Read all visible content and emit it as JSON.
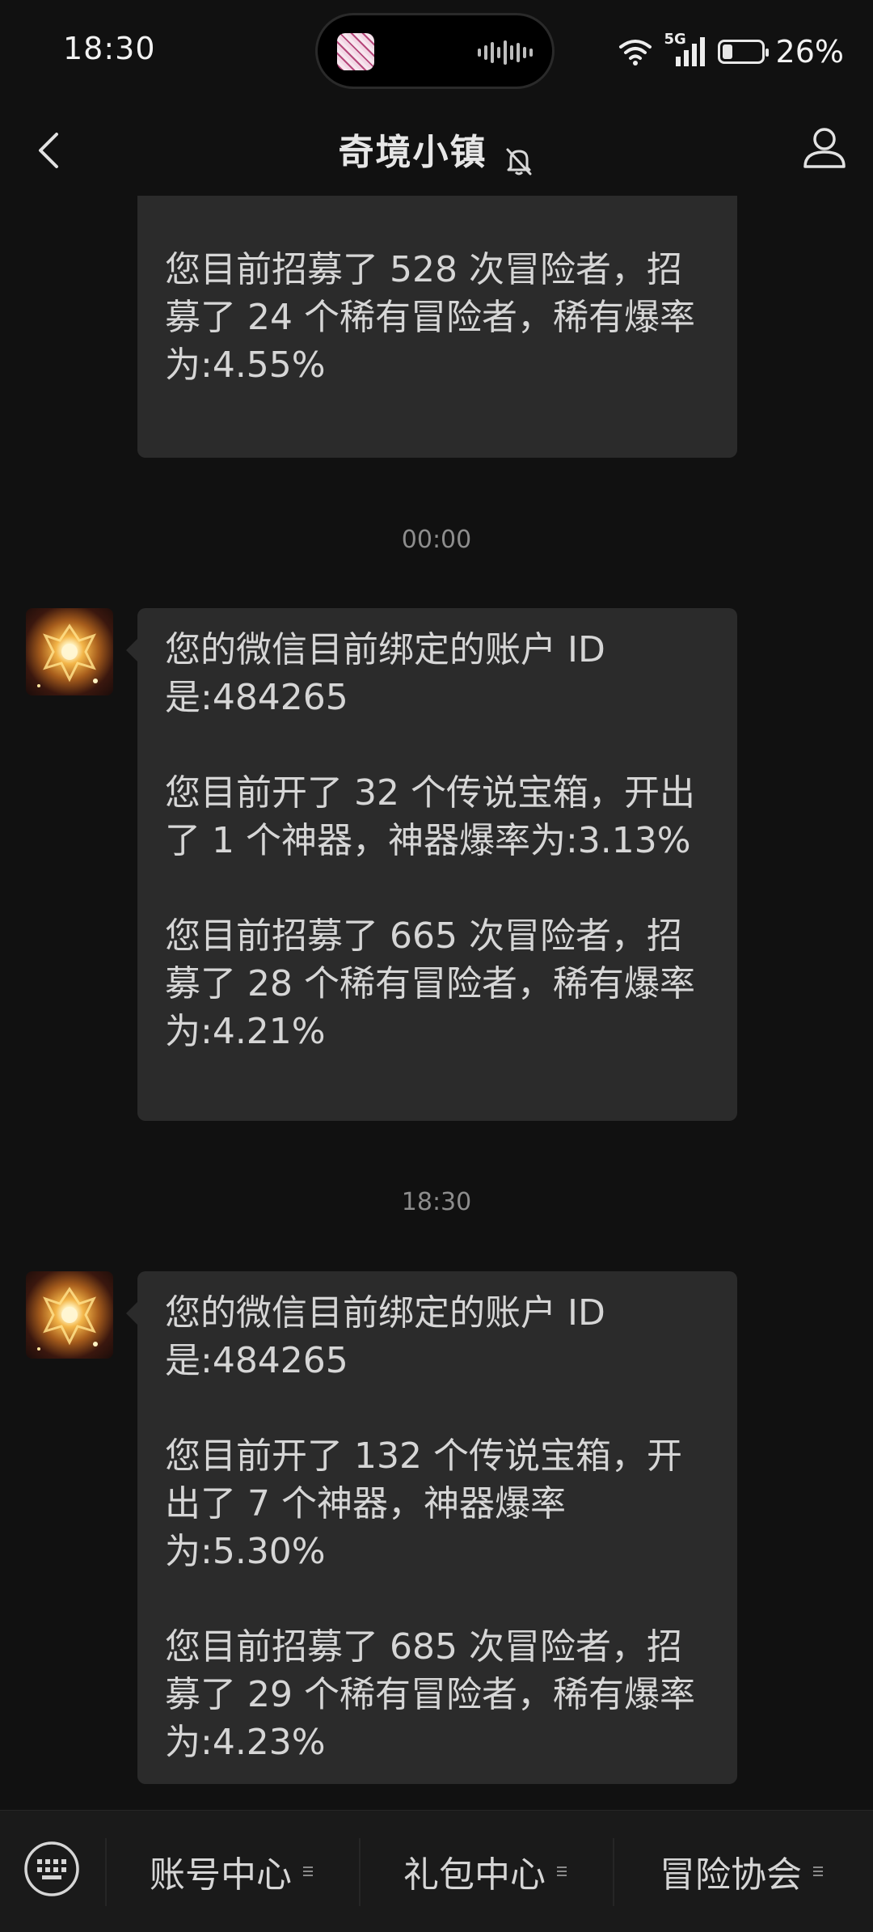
{
  "status_bar": {
    "time": "18:30",
    "network": "5G",
    "battery_percent": "26%",
    "battery_level": 0.26
  },
  "header": {
    "title": "奇境小镇"
  },
  "messages": [
    {
      "type": "bubble_partial",
      "paragraphs": [
        "您目前招募了 528 次冒险者，招募了 24 个稀有冒险者，稀有爆率为:4.55%"
      ]
    },
    {
      "type": "time",
      "text": "00:00"
    },
    {
      "type": "bubble",
      "paragraphs": [
        "您的微信目前绑定的账户 ID 是:484265",
        "您目前开了 32 个传说宝箱，开出了 1 个神器，神器爆率为:3.13%",
        "您目前招募了 665 次冒险者，招募了 28 个稀有冒险者，稀有爆率为:4.21%"
      ]
    },
    {
      "type": "time",
      "text": "18:30"
    },
    {
      "type": "bubble",
      "paragraphs": [
        "您的微信目前绑定的账户 ID 是:484265",
        "您目前开了 132 个传说宝箱，开出了 7 个神器，神器爆率为:5.30%",
        "您目前招募了 685 次冒险者，招募了 29 个稀有冒险者，稀有爆率为:4.23%"
      ]
    }
  ],
  "bottom_menu": {
    "items": [
      "账号中心",
      "礼包中心",
      "冒险协会"
    ]
  }
}
